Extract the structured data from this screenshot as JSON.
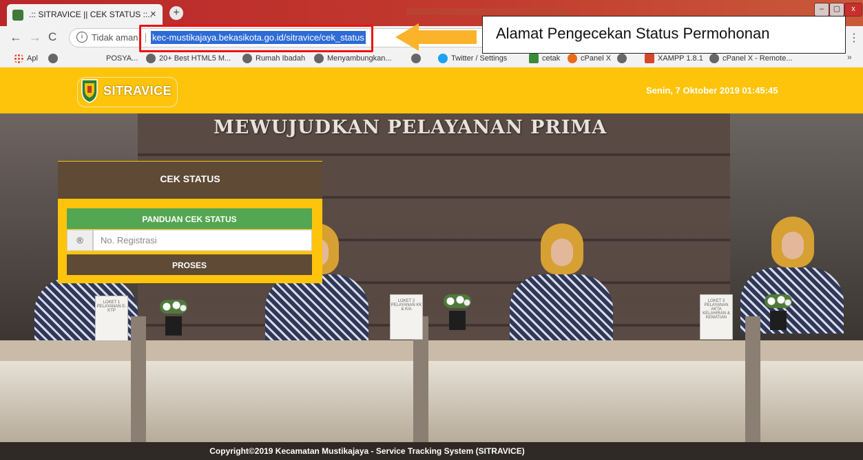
{
  "browser": {
    "tab_title": ".:: SITRAVICE || CEK STATUS ::..",
    "tab_close": "×",
    "new_tab": "+",
    "window_controls": {
      "minimize": "–",
      "maximize": "▢",
      "close": "x"
    },
    "nav": {
      "back": "←",
      "forward": "→",
      "reload": "C",
      "info_icon": "i",
      "menu": "⋮"
    },
    "security_label": "Tidak aman",
    "url": "kec-mustikajaya.bekasikota.go.id/sitravice/cek_status",
    "bookmarks": [
      {
        "label": "Apl",
        "icon": "apps-icon"
      },
      {
        "label": "",
        "icon": "globe-icon"
      },
      {
        "label": "POSYA...",
        "icon": ""
      },
      {
        "label": "20+ Best HTML5 M...",
        "icon": "globe-icon"
      },
      {
        "label": "Rumah Ibadah",
        "icon": "globe-icon"
      },
      {
        "label": "Menyambungkan...",
        "icon": "globe-icon"
      },
      {
        "label": "",
        "icon": "globe-icon"
      },
      {
        "label": "Twitter / Settings",
        "icon": "twitter-icon"
      },
      {
        "label": "cetak",
        "icon": "cetak-icon"
      },
      {
        "label": "cPanel X",
        "icon": "cpanel-icon"
      },
      {
        "label": "",
        "icon": "globe-icon"
      },
      {
        "label": "XAMPP 1.8.1",
        "icon": "xampp-icon"
      },
      {
        "label": "cPanel X - Remote...",
        "icon": "globe-icon"
      }
    ],
    "bookmarks_more": "»"
  },
  "header": {
    "logo_text": "SITRAVICE",
    "datetime": "Senin, 7 Oktober 2019 01:45:45"
  },
  "hero": {
    "slogan": "MEWUJUDKAN PELAYANAN PRIMA",
    "signs": [
      "LOKET 1 PELAYANAN E-KTP",
      "LOKET 2 PELAYANAN KK & KIA",
      "LOKET 3 PELAYANAN AKTA KELAHIRAN & KEMATIAN"
    ]
  },
  "cek_status": {
    "title": "CEK STATUS",
    "guide_button": "PANDUAN CEK STATUS",
    "input_addon": "®",
    "registration_placeholder": "No. Registrasi",
    "registration_value": "",
    "submit_button": "PROSES"
  },
  "footer": {
    "copyright": "Copyright©2019 Kecamatan Mustikajaya - Service Tracking System (SITRAVICE)"
  },
  "annotation": {
    "callout_text": "Alamat Pengecekan Status Permohonan",
    "highlight_color": "#ee1111",
    "arrow_color": "#fbb32c"
  },
  "colors": {
    "brand_yellow": "#fec40c",
    "panel_brown": "#5e4a35",
    "guide_green": "#53a652"
  }
}
